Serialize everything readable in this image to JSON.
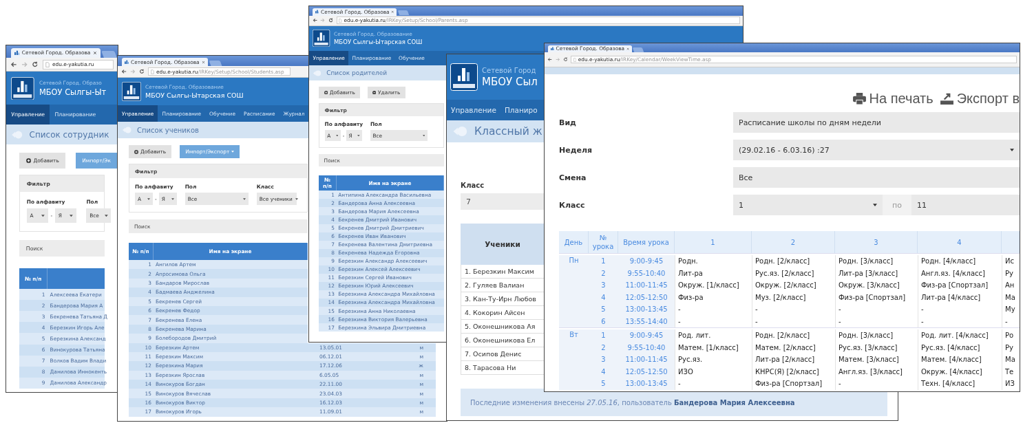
{
  "windows": [
    {
      "kind": "list",
      "tab_title": "Сетевой Город. Образова",
      "address": {
        "host": "edu.e-yakutia.ru"
      },
      "brand": "Сетевой Город. Образо",
      "school": "МБОУ Сылгы-Ыт",
      "menu": [
        {
          "label": "Управление",
          "selected": true
        },
        {
          "label": "Планирование",
          "selected": false
        }
      ],
      "page_title": "Список сотрудник",
      "buttons": [
        {
          "kind": "add",
          "label": "Добавить"
        },
        {
          "kind": "import",
          "label": "Импорт/Эк"
        }
      ],
      "filter": {
        "title": "Фильтр",
        "fields": [
          {
            "label": "По алфавиту",
            "separator": "-",
            "selects": [
              {
                "kind": "letter",
                "value": "А"
              },
              {
                "kind": "letter",
                "value": "Я"
              }
            ]
          },
          {
            "label": "Пол",
            "selects": [
              {
                "kind": "wide",
                "value": "Все"
              }
            ]
          }
        ]
      },
      "search_title": "Поиск",
      "table": {
        "columns": [
          "№ п/п"
        ],
        "rows": [
          {
            "num": "1",
            "name": "Алексеева Екатери"
          },
          {
            "num": "2",
            "name": "Бандерова Мария А"
          },
          {
            "num": "3",
            "name": "Бекренева Татьяна Д"
          },
          {
            "num": "4",
            "name": "Березкин Игорь Але"
          },
          {
            "num": "5",
            "name": "Березкина Александ"
          },
          {
            "num": "6",
            "name": "Винокурова Татьяна"
          },
          {
            "num": "7",
            "name": "Волков Вадим Влади"
          },
          {
            "num": "8",
            "name": "Данилова Иннокенть"
          },
          {
            "num": "9",
            "name": "Данилова Александр"
          }
        ]
      }
    },
    {
      "kind": "list",
      "tab_title": "Сетевой Город. Образова",
      "address": {
        "host": "edu.e-yakutia.ru",
        "path": "/IRKey/Setup/School/Students.asp"
      },
      "brand": "Сетевой Город. Образование",
      "school": "МБОУ Сылгы-Ытарская СОШ",
      "menu": [
        {
          "label": "Управление",
          "selected": true
        },
        {
          "label": "Планирование",
          "selected": false
        },
        {
          "label": "Обучение",
          "selected": false
        },
        {
          "label": "Расписание",
          "selected": false
        },
        {
          "label": "Журнал",
          "selected": false
        }
      ],
      "page_title": "Список учеников",
      "buttons": [
        {
          "kind": "add",
          "label": "Добавить"
        },
        {
          "kind": "menu",
          "label": "Импорт/Экспорт"
        }
      ],
      "filter": {
        "title": "Фильтр",
        "fields": [
          {
            "label": "По алфавиту",
            "separator": "-",
            "selects": [
              {
                "kind": "letter",
                "value": "А"
              },
              {
                "kind": "letter",
                "value": "Я"
              }
            ]
          },
          {
            "label": "Пол",
            "selects": [
              {
                "kind": "wide",
                "value": "Все"
              }
            ]
          },
          {
            "label": "Класс",
            "selects": [
              {
                "kind": "class",
                "value": "Все ученики"
              }
            ]
          }
        ]
      },
      "search_title": "Поиск",
      "table": {
        "columns": [
          "№ п/п",
          "Имя на экране"
        ],
        "rows": [
          {
            "num": "1",
            "name": "Ангилов Артем"
          },
          {
            "num": "2",
            "name": "Апросимова Ольга"
          },
          {
            "num": "3",
            "name": "Бандаров Мирослав"
          },
          {
            "num": "4",
            "name": "Бадмаева Анджелина"
          },
          {
            "num": "5",
            "name": "Бекренев Сергей"
          },
          {
            "num": "6",
            "name": "Бекренев Федор"
          },
          {
            "num": "7",
            "name": "Бекренева Елена"
          },
          {
            "num": "8",
            "name": "Бекренева Марина"
          },
          {
            "num": "9",
            "name": "Болебородов Дмитрий"
          },
          {
            "num": "10",
            "name": "Березкин Артем",
            "column_3": "13.05.01",
            "column_4": "м"
          },
          {
            "num": "11",
            "name": "Березкин Максим",
            "column_3": "06.12.01",
            "column_4": "м"
          },
          {
            "num": "12",
            "name": "Березкина Мария",
            "column_3": "17.12.06",
            "column_4": "ж"
          },
          {
            "num": "13",
            "name": "Березкин Ярослав",
            "column_3": "6.05.05",
            "column_4": "м"
          },
          {
            "num": "14",
            "name": "Винокуров Богдан",
            "column_3": "22.11.00",
            "column_4": "м"
          },
          {
            "num": "15",
            "name": "Винокуров Вячеслав",
            "column_3": "23.04.03",
            "column_4": "м"
          },
          {
            "num": "16",
            "name": "Винокуров Виктор",
            "column_3": "16.12.03",
            "column_4": "м"
          },
          {
            "num": "17",
            "name": "Винокуров Игорь",
            "column_3": "11.09.01",
            "column_4": "м"
          }
        ]
      }
    },
    {
      "kind": "list",
      "tab_title": "Сетевой Город. Образова",
      "address": {
        "host": "edu.e-yakutia.ru",
        "path": "/IRKey/Setup/School/Parents.asp"
      },
      "brand": "Сетевой Город. Образование",
      "school": "МБОУ Сылгы-Ытарская СОШ",
      "menu": [
        {
          "label": "Управление",
          "selected": true
        },
        {
          "label": "Планирование",
          "selected": false
        },
        {
          "label": "Обучение",
          "selected": false
        }
      ],
      "page_title": "Список родителей",
      "buttons": [
        {
          "kind": "add",
          "label": "Добавить"
        },
        {
          "kind": "delete",
          "label": "Удалить"
        }
      ],
      "filter": {
        "title": "Фильтр",
        "fields": [
          {
            "label": "По алфавиту",
            "separator": "-",
            "selects": [
              {
                "kind": "letter",
                "value": "А"
              },
              {
                "kind": "letter",
                "value": "Я"
              }
            ]
          },
          {
            "label": "Пол",
            "selects": [
              {
                "kind": "wide",
                "value": "Все"
              }
            ]
          }
        ]
      },
      "search_title": "Поиск",
      "table": {
        "columns": [
          "№ п/п",
          "Имя на экране"
        ],
        "rows": [
          {
            "num": "1",
            "name": "Антипина Александра Васильевна"
          },
          {
            "num": "2",
            "name": "Бандерова Анна Алексеевна"
          },
          {
            "num": "3",
            "name": "Бандерова Мария Алексеевна"
          },
          {
            "num": "4",
            "name": "Бекренев Дмитрий Иванович"
          },
          {
            "num": "5",
            "name": "Бекренев Дмитрий Дмитриевич"
          },
          {
            "num": "6",
            "name": "Бекренев Иван Иванович"
          },
          {
            "num": "7",
            "name": "Бекренева Валентина Дмитриевна"
          },
          {
            "num": "8",
            "name": "Бекренева Надежда Егоровна"
          },
          {
            "num": "9",
            "name": "Березкин Александр Алексеевич"
          },
          {
            "num": "10",
            "name": "Березкин Алексей Алексеевич"
          },
          {
            "num": "11",
            "name": "Березкин Сергей Иванович"
          },
          {
            "num": "12",
            "name": "Березкин Юрий Алексеевич"
          },
          {
            "num": "13",
            "name": "Березкина Александра Михайловна"
          },
          {
            "num": "14",
            "name": "Березкина Александра Михайловна"
          },
          {
            "num": "15",
            "name": "Березкина Анна Николаевна"
          },
          {
            "num": "16",
            "name": "Березкина Виктория Валерьевна"
          },
          {
            "num": "17",
            "name": "Березкина Эльвира Дмитриевна"
          }
        ]
      }
    },
    {
      "kind": "journal",
      "brand": "Сетевой Город",
      "school": "МБОУ Сыл",
      "menu": [
        {
          "label": "Управление",
          "selected": false
        },
        {
          "label": "Планиро",
          "selected": false
        }
      ],
      "page_title": "Классный ж",
      "class_label": "Класс",
      "class_value": "7",
      "table": {
        "column": "Ученики",
        "rows": [
          "1. Березкин Максим",
          "2. Гуляев Валиан",
          "3. Кан-Ту-Ирн Любов",
          "4. Кокорин Айсен",
          "5. Оконешникова Ая",
          "6. Оконешникова Ел",
          "7. Осипов Денис",
          "8. Тарасова Ни"
        ]
      },
      "footer": "Последние изменения внесены *27.05.16*, пользователь **Бандерова Мария Алексеевна**"
    },
    {
      "kind": "schedule",
      "tab_title": "Сетевой Город. Образова",
      "address": {
        "host": "edu.e-yakutia.ru",
        "path": "/IRKey/Calendar/WeekViewTime.asp"
      },
      "actions": [
        {
          "kind": "print",
          "label": "На печать"
        },
        {
          "kind": "export",
          "label": "Экспорт в"
        }
      ],
      "form": [
        {
          "kind": "select",
          "label": "Вид",
          "value": "Расписание школы по дням недели",
          "caret": false
        },
        {
          "kind": "select",
          "label": "Неделя",
          "value": "(29.02.16 - 6.03.16) :27",
          "caret": true
        },
        {
          "kind": "select",
          "label": "Смена",
          "value": "Все",
          "caret": false
        },
        {
          "kind": "range",
          "label": "Класс",
          "from": "1",
          "separator": "по",
          "to": "11"
        }
      ],
      "schedule": {
        "columns": [
          "День",
          "№ урока",
          "Время урока",
          "1",
          "2",
          "3",
          "4"
        ],
        "days": [
          {
            "day": "Пн",
            "lessons": [
              {
                "num": "1",
                "time": "9:00-9:45",
                "subjects": [
                  "Родн.",
                  "Родн. [2/класс]",
                  "Родн. [3/класс]",
                  "Родн. [4/класс]",
                  "Ис"
                ]
              },
              {
                "num": "2",
                "time": "9:55-10:40",
                "subjects": [
                  "Лит-ра",
                  "Рус.яз. [2/класс]",
                  "Лит-ра [3/класс]",
                  "Англ.яз. [4/класс]",
                  "Ру"
                ]
              },
              {
                "num": "3",
                "time": "11:00-11:45",
                "subjects": [
                  "Окруж. [1/класс]",
                  "Окруж. [2/класс]",
                  "Окруж. [3/класс]",
                  "Физ-ра [Спортзал]",
                  "Ан"
                ]
              },
              {
                "num": "4",
                "time": "12:05-12:50",
                "subjects": [
                  "Физ-ра",
                  "Муз. [2/класс]",
                  "Физ-ра [Спортзал]",
                  "Лит-ра [4/класс]",
                  "Ма"
                ]
              },
              {
                "num": "5",
                "time": "13:00-13:45",
                "subjects": [
                  "-",
                  "-",
                  "-",
                  "-",
                  "Му"
                ]
              },
              {
                "num": "6",
                "time": "13:55-14:40",
                "subjects": [
                  "-",
                  "-",
                  "-",
                  "-",
                  "-"
                ]
              }
            ]
          },
          {
            "day": "Вт",
            "lessons": [
              {
                "num": "1",
                "time": "9:00-9:45",
                "subjects": [
                  "Род. лит.",
                  "Родн. [2/класс]",
                  "Родн. [3/класс]",
                  "Род. лит. [4/класс]",
                  "Ро"
                ]
              },
              {
                "num": "2",
                "time": "9:55-10:40",
                "subjects": [
                  "Матем. [1/класс]",
                  "Матем. [2/класс]",
                  "Рус.яз. [3/класс]",
                  "Рус.яз. [4/класс]",
                  "Ру"
                ]
              },
              {
                "num": "3",
                "time": "11:00-11:45",
                "subjects": [
                  "Рус.яз.",
                  "Лит-ра [2/класс]",
                  "Матем. [3/класс]",
                  "Матем. [4/класс]",
                  "Ма"
                ]
              },
              {
                "num": "4",
                "time": "12:05-12:50",
                "subjects": [
                  "ИЗО",
                  "КНРС(Я) [2/класс]",
                  "Англ.яз. [3/класс]",
                  "Окруж. [4/класс]",
                  "Те"
                ]
              },
              {
                "num": "5",
                "time": "13:00-13:45",
                "subjects": [
                  "-",
                  "Физ-ра [Спортзал]",
                  "-",
                  "Техн. [4/класс]",
                  "ИЗ"
                ]
              }
            ]
          }
        ]
      }
    }
  ]
}
